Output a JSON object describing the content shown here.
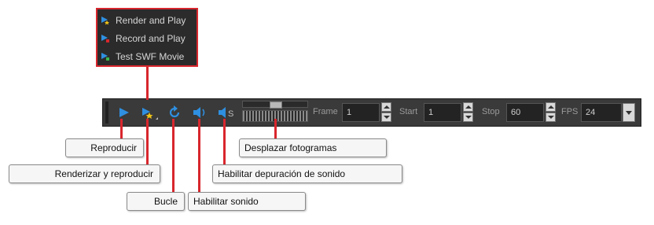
{
  "menu": {
    "items": [
      {
        "label": "Render and Play",
        "icon": "render-play-icon"
      },
      {
        "label": "Record and Play",
        "icon": "record-play-icon"
      },
      {
        "label": "Test SWF Movie",
        "icon": "test-swf-icon"
      }
    ]
  },
  "toolbar": {
    "icons": [
      "play-icon",
      "render-play-icon",
      "loop-icon",
      "sound-icon",
      "sound-scrub-icon"
    ],
    "frame_label": "Frame",
    "frame_value": "1",
    "start_label": "Start",
    "start_value": "1",
    "stop_label": "Stop",
    "stop_value": "60",
    "fps_label": "FPS",
    "fps_value": "24"
  },
  "callouts": {
    "play": "Reproducir",
    "render_play": "Renderizar y reproducir",
    "loop": "Bucle",
    "sound": "Habilitar sonido",
    "sound_scrub": "Habilitar depuración de sonido",
    "scrub_frames": "Desplazar fotogramas"
  },
  "colors": {
    "accent_blue": "#2f8fe0",
    "highlight_red": "#d8262d",
    "toolbar_bg": "#3a3a3a",
    "menu_bg": "#2b2b2b"
  }
}
